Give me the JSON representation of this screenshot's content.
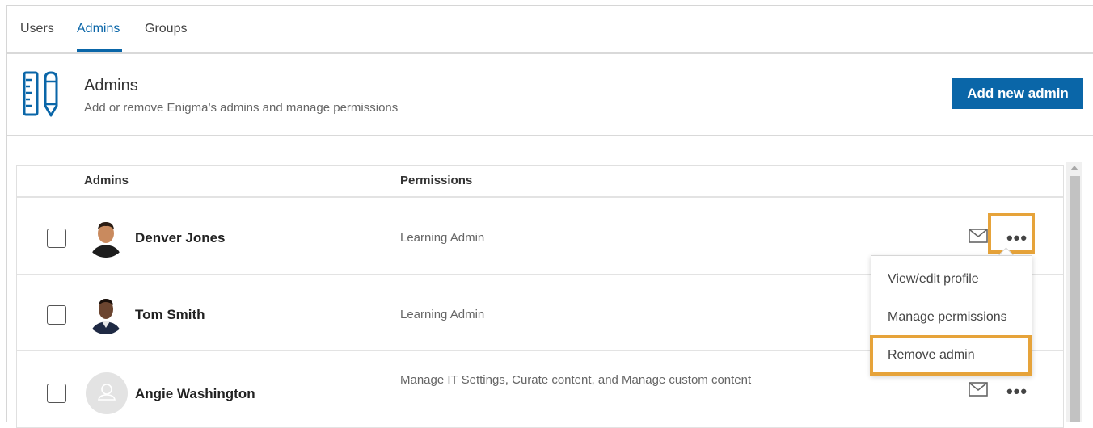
{
  "tabs": [
    {
      "label": "Users",
      "active": false
    },
    {
      "label": "Admins",
      "active": true
    },
    {
      "label": "Groups",
      "active": false
    }
  ],
  "header": {
    "icon": "ruler-pencil-icon",
    "title": "Admins",
    "subtitle": "Add or remove Enigma’s admins and manage permissions",
    "add_button": "Add new admin"
  },
  "table": {
    "columns": {
      "admins": "Admins",
      "permissions": "Permissions"
    },
    "rows": [
      {
        "name": "Denver Jones",
        "permission": "Learning Admin",
        "avatar": "photo-avatar"
      },
      {
        "name": "Tom Smith",
        "permission": "Learning Admin",
        "avatar": "photo-avatar"
      },
      {
        "name": "Angie Washington",
        "permission": "Manage IT Settings, Curate content, and Manage custom content",
        "avatar": "placeholder-avatar"
      }
    ]
  },
  "menu": {
    "items": [
      "View/edit profile",
      "Manage permissions",
      "Remove admin"
    ]
  },
  "more_glyph": "•••",
  "colors": {
    "accent": "#0a66a8",
    "highlight": "#e6a33a"
  }
}
